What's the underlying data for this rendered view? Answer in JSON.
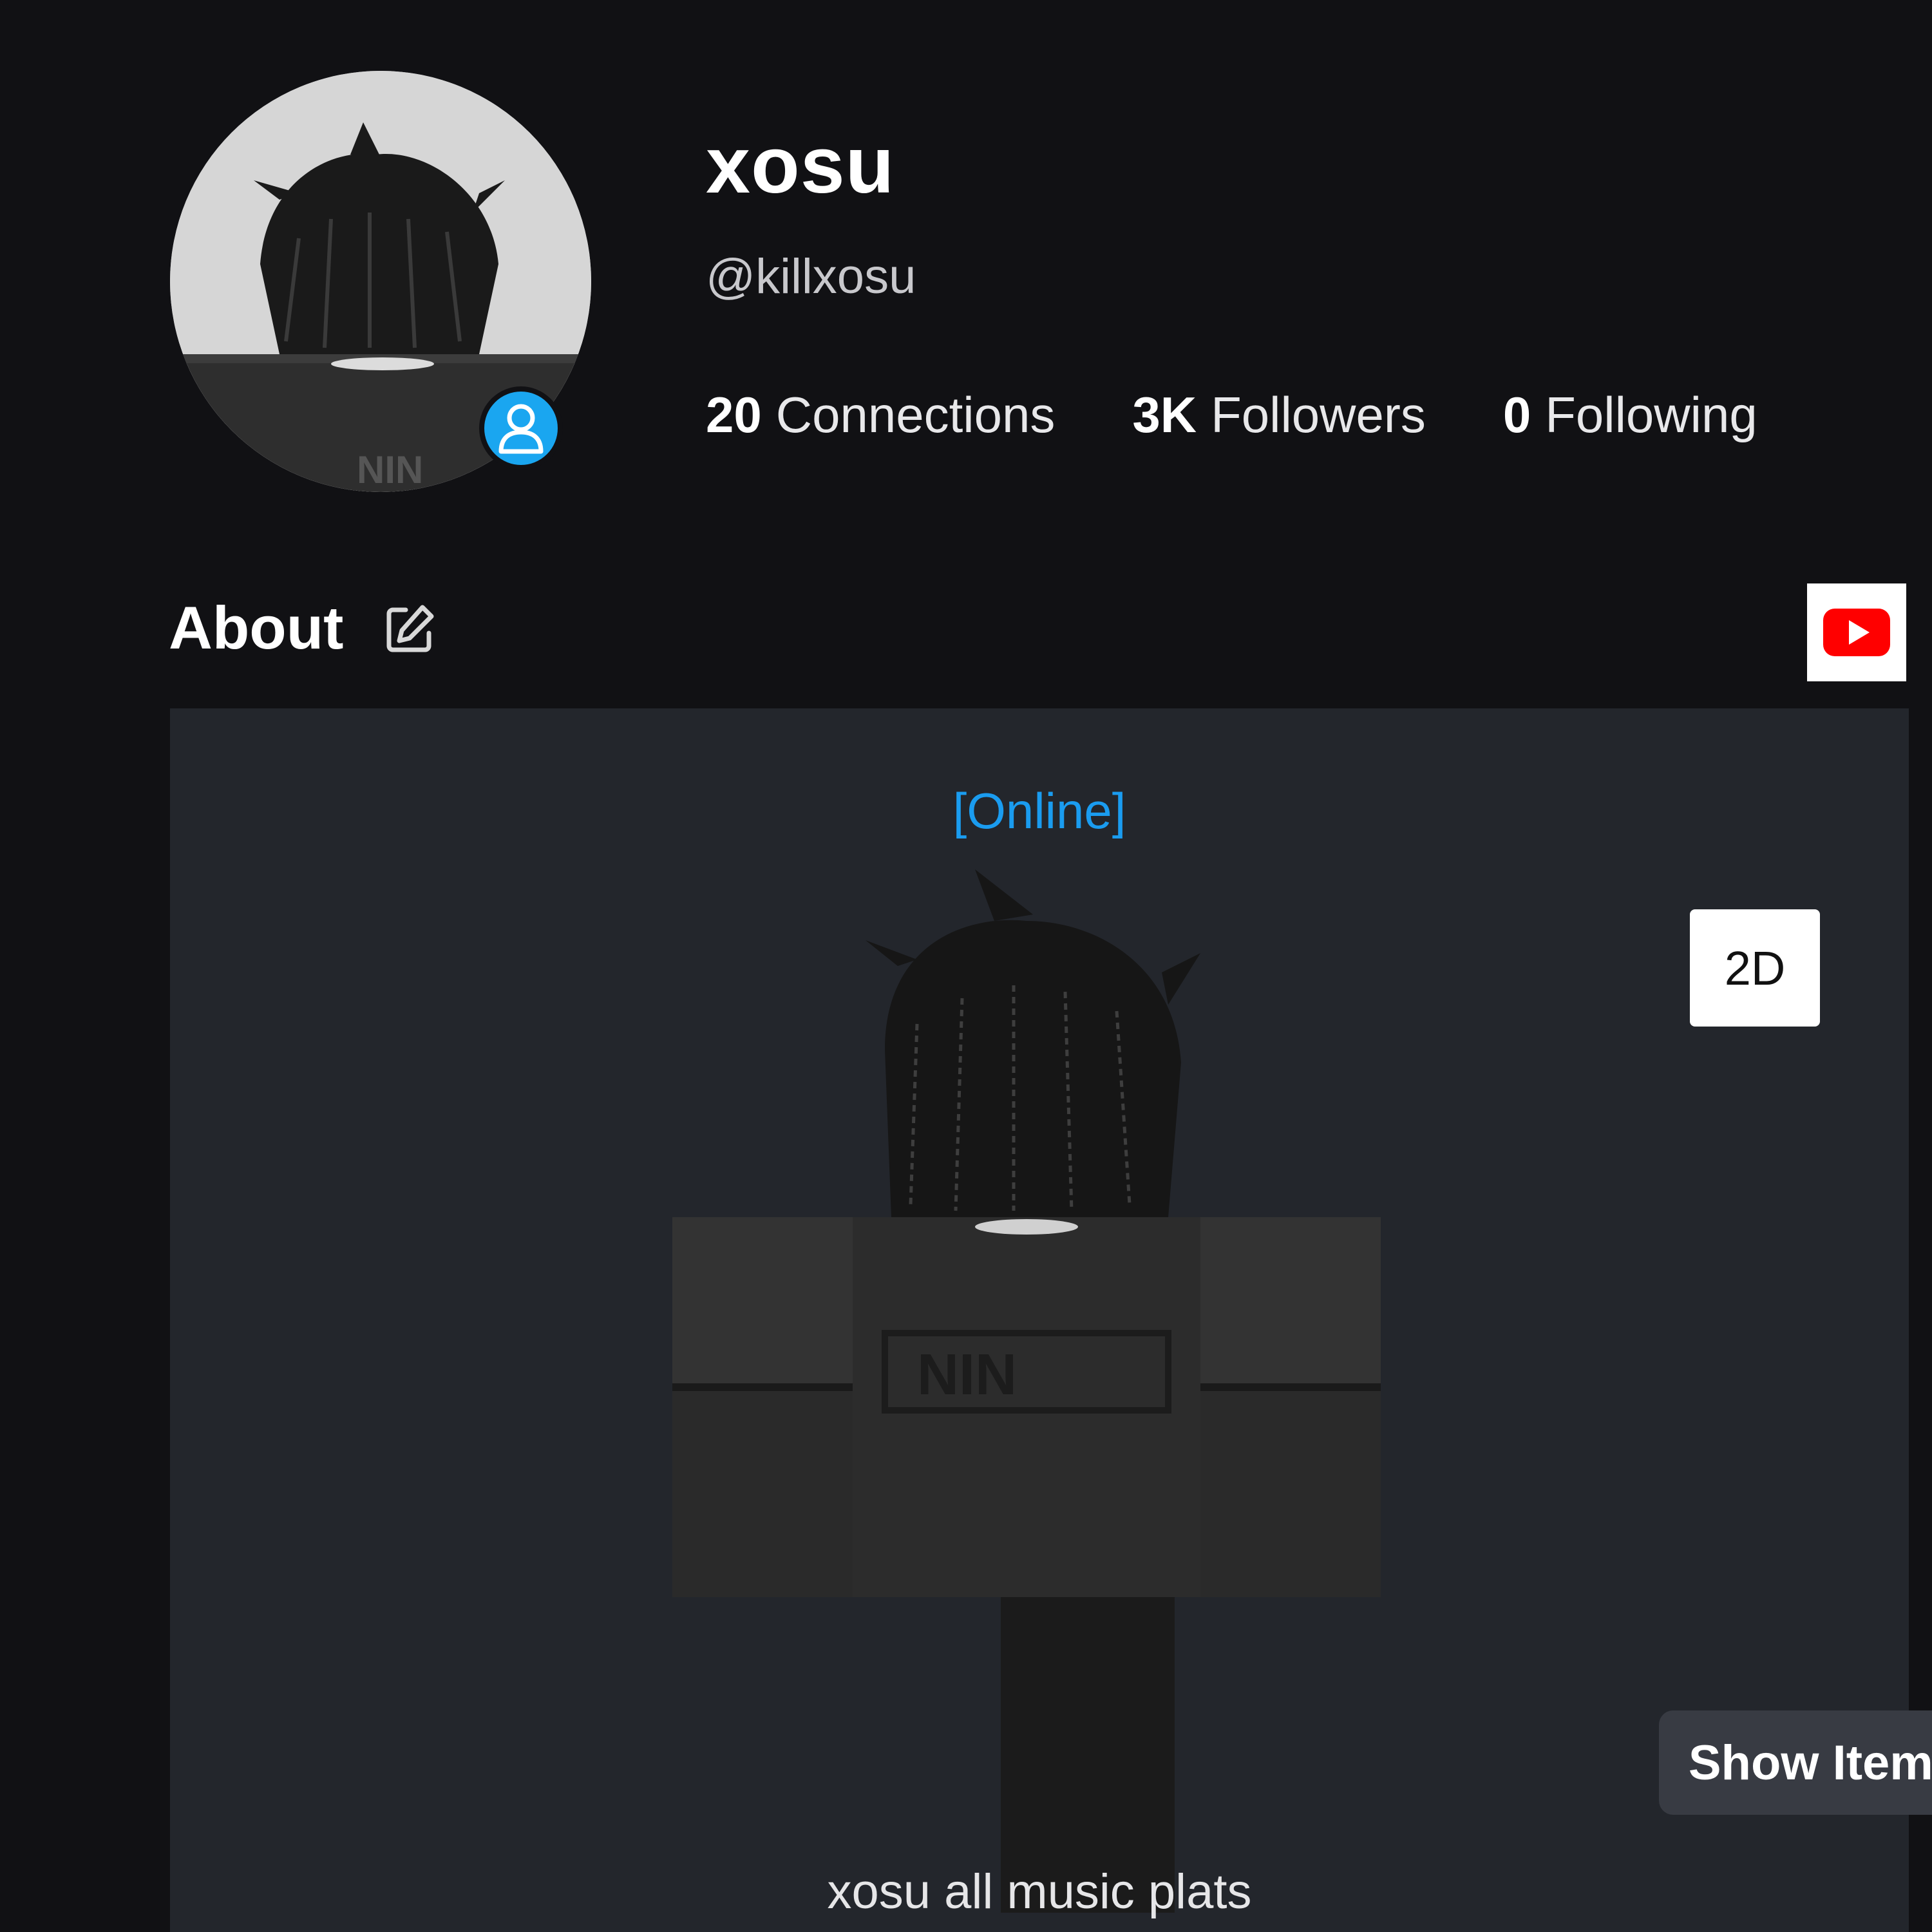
{
  "profile": {
    "display_name": "xosu",
    "username": "@killxosu",
    "presence_status_icon": "person-icon",
    "stats": [
      {
        "value": "20",
        "label": "Connections"
      },
      {
        "value": "3K",
        "label": "Followers"
      },
      {
        "value": "0",
        "label": "Following"
      }
    ]
  },
  "about": {
    "title": "About",
    "edit_icon": "pencil-square-icon",
    "social_icon": "youtube-icon"
  },
  "avatar_panel": {
    "status": "[Online]",
    "toggle_label": "2D",
    "show_items_label": "Show Items",
    "bio": "xosu all music plats"
  },
  "colors": {
    "background": "#111114",
    "panel": "#23262c",
    "online_blue": "#1a9cf0",
    "badge_blue": "#1aa6f0",
    "youtube_red": "#ff0000"
  }
}
